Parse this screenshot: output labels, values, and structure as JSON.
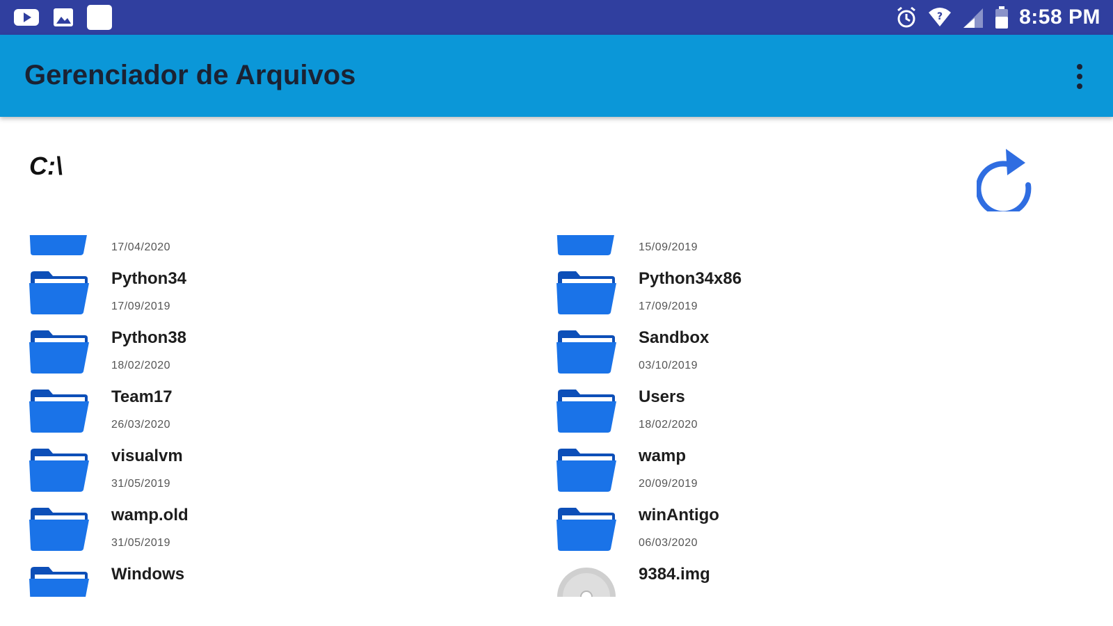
{
  "status_bar": {
    "left_icons": [
      "youtube-icon",
      "gallery-icon",
      "app-notification-icon"
    ],
    "right_icons": [
      "alarm-icon",
      "wifi-icon",
      "signal-icon",
      "battery-icon"
    ],
    "time": "8:58 PM",
    "background": "#303f9f"
  },
  "app_bar": {
    "title": "Gerenciador de Arquivos",
    "menu_icon": "overflow-menu-icon",
    "background": "#0b97d8"
  },
  "path": "C:\\",
  "refresh_icon": "refresh-icon",
  "files": [
    {
      "name": "",
      "date": "17/04/2020",
      "icon": "folder-icon"
    },
    {
      "name": "",
      "date": "15/09/2019",
      "icon": "folder-icon"
    },
    {
      "name": "Python34",
      "date": "17/09/2019",
      "icon": "folder-icon"
    },
    {
      "name": "Python34x86",
      "date": "17/09/2019",
      "icon": "folder-icon"
    },
    {
      "name": "Python38",
      "date": "18/02/2020",
      "icon": "folder-icon"
    },
    {
      "name": "Sandbox",
      "date": "03/10/2019",
      "icon": "folder-icon"
    },
    {
      "name": "Team17",
      "date": "26/03/2020",
      "icon": "folder-icon"
    },
    {
      "name": "Users",
      "date": "18/02/2020",
      "icon": "folder-icon"
    },
    {
      "name": "visualvm",
      "date": "31/05/2019",
      "icon": "folder-icon"
    },
    {
      "name": "wamp",
      "date": "20/09/2019",
      "icon": "folder-icon"
    },
    {
      "name": "wamp.old",
      "date": "31/05/2019",
      "icon": "folder-icon"
    },
    {
      "name": "winAntigo",
      "date": "06/03/2020",
      "icon": "folder-icon"
    },
    {
      "name": "Windows",
      "date": "",
      "icon": "folder-icon"
    },
    {
      "name": "9384.img",
      "date": "",
      "icon": "disc-image-icon"
    }
  ],
  "colors": {
    "folder": "#1a73e8",
    "folder_dark": "#0d4fb8",
    "refresh": "#2f6de1"
  }
}
